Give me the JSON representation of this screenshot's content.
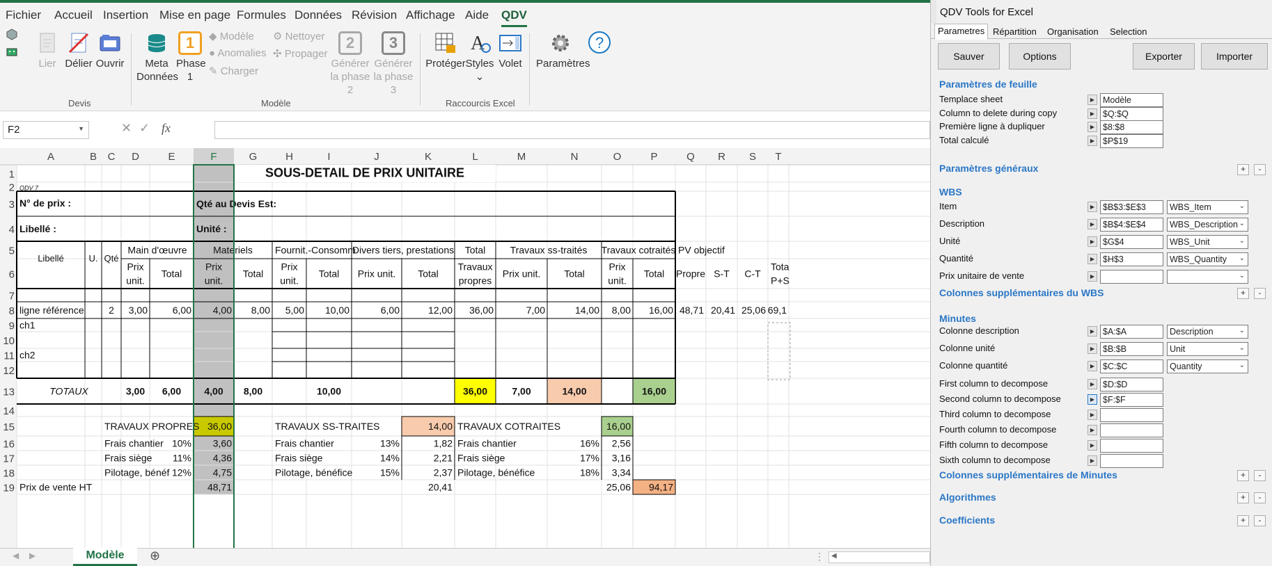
{
  "menu": [
    "Fichier",
    "Accueil",
    "Insertion",
    "Mise en page",
    "Formules",
    "Données",
    "Révision",
    "Affichage",
    "Aide",
    "QDV"
  ],
  "ribbon": {
    "lier": "Lier",
    "delier": "Délier",
    "ouvrir": "Ouvrir",
    "group_devis": "Devis",
    "meta1": "Meta",
    "meta2": "Données",
    "phase1": "Phase",
    "phase2": "1",
    "phase_num": "1",
    "modele": "Modèle",
    "anomalies": "Anomalies",
    "charger": "Charger",
    "nettoyer": "Nettoyer",
    "propager": "Propager",
    "gen2a": "Générer",
    "gen2b": "la phase 2",
    "gen2_num": "2",
    "gen3a": "Générer",
    "gen3b": "la phase 3",
    "gen3_num": "3",
    "group_modele": "Modèle",
    "proteger": "Protéger",
    "styles": "Styles",
    "volet": "Volet",
    "group_raccourcis": "Raccourcis Excel",
    "parametres": "Paramètres"
  },
  "formula_bar": {
    "namebox": "F2",
    "fx": "fx",
    "value": ""
  },
  "columns": {
    "letters": [
      "A",
      "B",
      "C",
      "D",
      "E",
      "F",
      "G",
      "H",
      "I",
      "J",
      "K",
      "L",
      "M",
      "N",
      "O",
      "P",
      "Q",
      "R",
      "S",
      "T"
    ],
    "rows": [
      "1",
      "2",
      "3",
      "4",
      "5",
      "6",
      "7",
      "8",
      "9",
      "10",
      "11",
      "12",
      "13",
      "14",
      "15",
      "16",
      "17",
      "18",
      "19"
    ]
  },
  "sheet": {
    "title": "SOUS-DETAIL DE PRIX UNITAIRE",
    "qdv": "QDV 7",
    "prix_label": "N° de prix :",
    "qte_label": "Qté au Devis Est:",
    "libelle_label": "Libellé :",
    "unite_label": "Unité :",
    "h_main": "Main d'œuvre",
    "h_materiels": "Materiels",
    "h_fournit": "Fournit.-Consomm",
    "h_divers": "Divers tiers, prestations",
    "h_total": "Total",
    "h_total2": "Travaux",
    "h_total3": "propres",
    "h_ss": "Travaux ss-traités",
    "h_cot": "Travaux cotraités",
    "h_pv": "PV objectif",
    "h_libelle": "Libellé",
    "h_u": "U.",
    "h_qte": "Qté",
    "h_prix": "Prix",
    "h_unit": "unit.",
    "h_tot": "Total",
    "h_prixunit": "Prix unit.",
    "h_propre": "Propre",
    "h_st": "S-T",
    "h_ct": "C-T",
    "h_tota": "Tota",
    "h_ps": "P+S",
    "r8": [
      "ligne référence",
      "2",
      "3,00",
      "6,00",
      "4,00",
      "8,00",
      "5,00",
      "10,00",
      "6,00",
      "12,00",
      "36,00",
      "7,00",
      "14,00",
      "8,00",
      "16,00",
      "48,71",
      "20,41",
      "25,06",
      "69,1"
    ],
    "ch1": "ch1",
    "ch2": "ch2",
    "totaux_label": "TOTAUX",
    "totaux": [
      "3,00",
      "6,00",
      "4,00",
      "8,00",
      "10,00",
      "36,00",
      "7,00",
      "14,00",
      "16,00"
    ],
    "tp": "TRAVAUX PROPRES",
    "tp_val": "36,00",
    "tss": "TRAVAUX SS-TRAITES",
    "tss_val": "14,00",
    "tc": "TRAVAUX COTRAITES",
    "tc_val": "16,00",
    "frais_chantier": "Frais chantier",
    "frais_siege": "Frais siège",
    "pilotage": "Pilotage, bénéf",
    "pilotage2": "Pilotage, bénéfice",
    "fc": [
      "10%",
      "3,60",
      "13%",
      "1,82",
      "16%",
      "2,56"
    ],
    "fs": [
      "11%",
      "4,36",
      "14%",
      "2,21",
      "17%",
      "3,16"
    ],
    "pb": [
      "12%",
      "4,75",
      "15%",
      "2,37",
      "18%",
      "3,34"
    ],
    "pv_label": "Prix de vente HT",
    "pv": [
      "48,71",
      "20,41",
      "25,06",
      "94,17"
    ]
  },
  "sheet_tab": "Modèle",
  "panel": {
    "title": "QDV Tools for Excel",
    "tabs": [
      "Parametres",
      "Répartition",
      "Organisation",
      "Selection"
    ],
    "btn_sauver": "Sauver",
    "btn_options": "Options",
    "btn_exporter": "Exporter",
    "btn_importer": "Importer",
    "sec_feuille": "Paramètres de feuille",
    "feuille": [
      {
        "label": "Templace sheet",
        "value": "Modèle"
      },
      {
        "label": "Column to delete during copy",
        "value": "$Q:$Q"
      },
      {
        "label": "Première ligne à dupliquer",
        "value": "$8:$8"
      },
      {
        "label": "Total calculé",
        "value": "$P$19"
      }
    ],
    "sec_generaux": "Paramètres généraux",
    "sec_wbs": "WBS",
    "wbs": [
      {
        "label": "Item",
        "value": "$B$3:$E$3",
        "sel": "WBS_Item"
      },
      {
        "label": "Description",
        "value": "$B$4:$E$4",
        "sel": "WBS_Description"
      },
      {
        "label": "Unité",
        "value": "$G$4",
        "sel": "WBS_Unit"
      },
      {
        "label": "Quantité",
        "value": "$H$3",
        "sel": "WBS_Quantity"
      },
      {
        "label": "Prix unitaire de vente",
        "value": "",
        "sel": ""
      }
    ],
    "sec_wbs_extra": "Colonnes supplémentaires du WBS",
    "sec_minutes": "Minutes",
    "minutes": [
      {
        "label": "Colonne description",
        "value": "$A:$A",
        "sel": "Description"
      },
      {
        "label": "Colonne unité",
        "value": "$B:$B",
        "sel": "Unit"
      },
      {
        "label": "Colonne quantité",
        "value": "$C:$C",
        "sel": "Quantity"
      }
    ],
    "decompose": [
      {
        "label": "First column to decompose",
        "value": "$D:$D"
      },
      {
        "label": "Second column to decompose",
        "value": "$F:$F"
      },
      {
        "label": "Third column to decompose",
        "value": ""
      },
      {
        "label": "Fourth column to decompose",
        "value": ""
      },
      {
        "label": "Fifth column to decompose",
        "value": ""
      },
      {
        "label": "Sixth column to decompose",
        "value": ""
      }
    ],
    "sec_min_extra": "Colonnes supplémentaires de Minutes",
    "sec_algo": "Algorithmes",
    "sec_coef": "Coefficients",
    "plus": "+",
    "minus": "-"
  },
  "colors": {
    "excel_green": "#217346",
    "yellow": "#ffff00",
    "salmon": "#f8cbad",
    "green_fill": "#a9d08e",
    "olive": "#c9c900",
    "orange": "#f4b183",
    "sel_col": "#c0c0c0",
    "link_blue": "#2b77c6"
  }
}
